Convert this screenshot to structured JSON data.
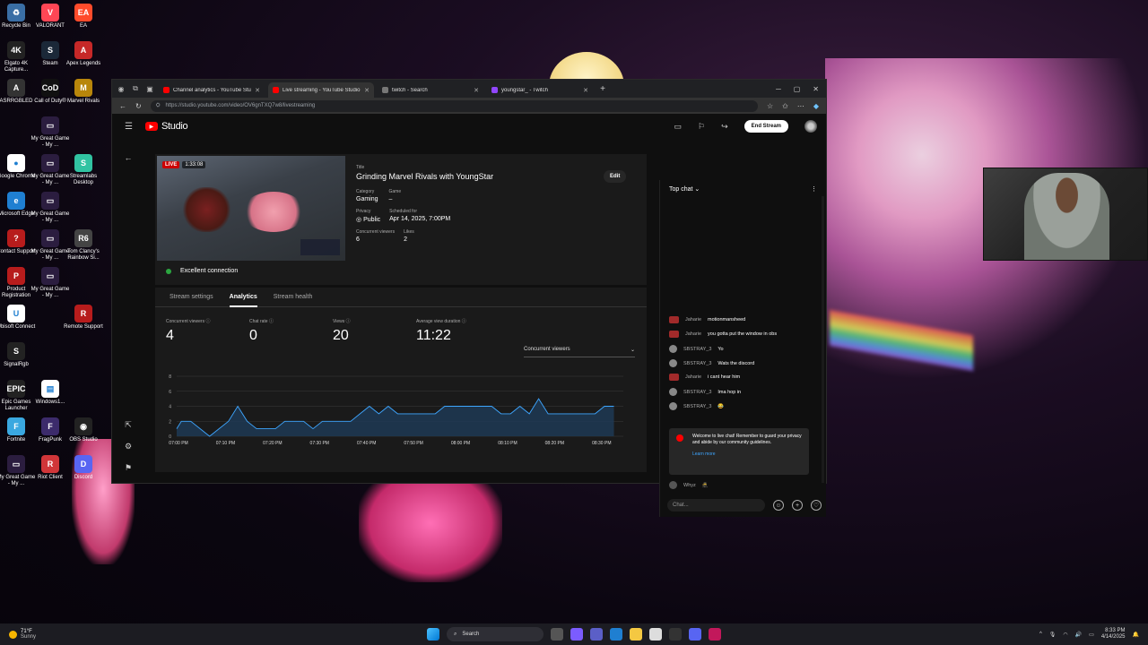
{
  "desktop": {
    "icons": [
      {
        "label": "Recycle Bin",
        "color": "#3a6ea5",
        "glyph": "♻"
      },
      {
        "label": "VALORANT",
        "color": "#ff4655",
        "glyph": "V"
      },
      {
        "label": "EA",
        "color": "#ff4b2b",
        "glyph": "EA"
      },
      {
        "label": "Elgato 4K Capture...",
        "color": "#222",
        "glyph": "4K"
      },
      {
        "label": "Steam",
        "color": "#1b2838",
        "glyph": "S"
      },
      {
        "label": "Apex Legends",
        "color": "#c62828",
        "glyph": "A"
      },
      {
        "label": "ASRRGBLED",
        "color": "#333",
        "glyph": "A"
      },
      {
        "label": "Call of Duty®",
        "color": "#111",
        "glyph": "CoD"
      },
      {
        "label": "Marvel Rivals",
        "color": "#b8860b",
        "glyph": "M"
      },
      {
        "label": "My Great Game - My ...",
        "color": "#2b1d3f",
        "glyph": "▭"
      },
      {
        "label": "Google Chrome",
        "color": "#fff",
        "glyph": "●"
      },
      {
        "label": "My Great Game - My ...",
        "color": "#2b1d3f",
        "glyph": "▭"
      },
      {
        "label": "Streamlabs Desktop",
        "color": "#31c3a2",
        "glyph": "S"
      },
      {
        "label": "Microsoft Edge",
        "color": "#1f7fd1",
        "glyph": "e"
      },
      {
        "label": "My Great Game - My ...",
        "color": "#2b1d3f",
        "glyph": "▭"
      },
      {
        "label": "Contact Support",
        "color": "#b71c1c",
        "glyph": "?"
      },
      {
        "label": "My Great Game - My ...",
        "color": "#2b1d3f",
        "glyph": "▭"
      },
      {
        "label": "Tom Clancy's Rainbow Si...",
        "color": "#444",
        "glyph": "R6"
      },
      {
        "label": "Product Registration",
        "color": "#b71c1c",
        "glyph": "P"
      },
      {
        "label": "My Great Game - My ...",
        "color": "#2b1d3f",
        "glyph": "▭"
      },
      {
        "label": "Ubisoft Connect",
        "color": "#fff",
        "glyph": "U"
      },
      {
        "label": "Remote Support",
        "color": "#b71c1c",
        "glyph": "R"
      },
      {
        "label": "SignalRgb",
        "color": "#222",
        "glyph": "S"
      },
      {
        "label": "Epic Games Launcher",
        "color": "#222",
        "glyph": "EPIC"
      },
      {
        "label": "Windows1...",
        "color": "#fff",
        "glyph": "▤"
      },
      {
        "label": "Fortnite",
        "color": "#3aa8e0",
        "glyph": "F"
      },
      {
        "label": "FragPunk",
        "color": "#3c2b6b",
        "glyph": "F"
      },
      {
        "label": "OBS Studio",
        "color": "#222",
        "glyph": "◉"
      },
      {
        "label": "My Great Game - My ...",
        "color": "#2b1d3f",
        "glyph": "▭"
      },
      {
        "label": "Riot Client",
        "color": "#d13639",
        "glyph": "R"
      },
      {
        "label": "Discord",
        "color": "#5865f2",
        "glyph": "D"
      },
      {
        "label": "My Great Game - My ...",
        "color": "#2b1d3f",
        "glyph": "▭"
      },
      {
        "label": "My Great Game - My ...",
        "color": "#2b1d3f",
        "glyph": "▭"
      }
    ]
  },
  "browser": {
    "tabs": [
      {
        "title": "Channel analytics - YouTube Studio",
        "color": "#ff0000",
        "active": false
      },
      {
        "title": "Live streaming - YouTube Studio",
        "color": "#ff0000",
        "active": true
      },
      {
        "title": "twitch - Search",
        "color": "#777",
        "active": false
      },
      {
        "title": "youngstar_ - Twitch",
        "color": "#9146ff",
        "active": false
      }
    ],
    "url": "https://studio.youtube.com/video/OV6gnTXQ7w8/livestreaming"
  },
  "studio": {
    "logo_text": "Studio",
    "end_stream_label": "End Stream",
    "stream": {
      "live_label": "LIVE",
      "duration": "1:33:08",
      "title_label": "Title",
      "title": "Grinding Marvel Rivals with YoungStar",
      "category_label": "Category",
      "category": "Gaming",
      "game_label": "Game",
      "game": "–",
      "privacy_label": "Privacy",
      "privacy": "Public",
      "scheduled_label": "Scheduled for",
      "scheduled": "Apr 14, 2025, 7:00PM",
      "concurrent_label": "Concurrent viewers",
      "concurrent": "6",
      "likes_label": "Likes",
      "likes": "2",
      "edit_label": "Edit",
      "connection": "Excellent connection"
    },
    "analytics": {
      "tabs": [
        "Stream settings",
        "Analytics",
        "Stream health"
      ],
      "active_tab": "Analytics",
      "stats": [
        {
          "label": "Concurrent viewers",
          "value": "4"
        },
        {
          "label": "Chat rate",
          "value": "0"
        },
        {
          "label": "Views",
          "value": "20"
        },
        {
          "label": "Average view duration",
          "value": "11:22"
        }
      ],
      "metric_select": "Concurrent viewers"
    }
  },
  "chart_data": {
    "type": "area",
    "title": "",
    "xlabel": "",
    "ylabel": "",
    "ylim": [
      0,
      8
    ],
    "yticks": [
      0,
      2,
      4,
      6,
      8
    ],
    "xticks": [
      "07:00 PM",
      "07:10 PM",
      "07:20 PM",
      "07:30 PM",
      "07:40 PM",
      "07:50 PM",
      "08:00 PM",
      "08:10 PM",
      "08:20 PM",
      "08:30 PM"
    ],
    "x_minutes": [
      0,
      1,
      3,
      5,
      7,
      9,
      11,
      13,
      15,
      17,
      19,
      21,
      23,
      25,
      27,
      29,
      31,
      33,
      35,
      37,
      39,
      41,
      43,
      45,
      47,
      49,
      51,
      53,
      55,
      57,
      59,
      61,
      63,
      65,
      67,
      69,
      71,
      73,
      75,
      77,
      79,
      81,
      83,
      85,
      87,
      89,
      91,
      93
    ],
    "series": [
      {
        "values": [
          1,
          2,
          2,
          1,
          0,
          1,
          2,
          4,
          2,
          1,
          1,
          1,
          2,
          2,
          2,
          1,
          2,
          2,
          2,
          2,
          3,
          4,
          3,
          4,
          3,
          3,
          3,
          3,
          3,
          4,
          4,
          4,
          4,
          4,
          4,
          3,
          3,
          4,
          3,
          5,
          3,
          3,
          3,
          3,
          3,
          3,
          4,
          4
        ]
      }
    ],
    "grid": true,
    "color": "#3ea6ff"
  },
  "chat": {
    "header": "Top chat",
    "messages": [
      {
        "name": "Jaharie",
        "text": "motionmansheed",
        "avatar_color": "#a12a2a"
      },
      {
        "name": "Jaharie",
        "text": "you gotta put the window in obs",
        "avatar_color": "#a12a2a"
      },
      {
        "name": "SBSTRAY_3",
        "text": "Yo",
        "avatar_color": "#888"
      },
      {
        "name": "SBSTRAY_3",
        "text": "Wats the discord",
        "avatar_color": "#888"
      },
      {
        "name": "Jaharie",
        "text": "i cant hear him",
        "avatar_color": "#a12a2a"
      },
      {
        "name": "SBSTRAY_3",
        "text": "Ima hop in",
        "avatar_color": "#888"
      },
      {
        "name": "SBSTRAY_3",
        "text": "😂",
        "avatar_color": "#888"
      }
    ],
    "welcome_text": "Welcome to live chat! Remember to guard your privacy and abide by our community guidelines.",
    "learn_more": "Learn more",
    "last_message": {
      "name": "Whyz",
      "text": "🥷"
    },
    "input_placeholder": "Chat..."
  },
  "taskbar": {
    "temp": "71°F",
    "weather": "Sunny",
    "search": "Search",
    "time": "8:33 PM",
    "date": "4/14/2025"
  }
}
